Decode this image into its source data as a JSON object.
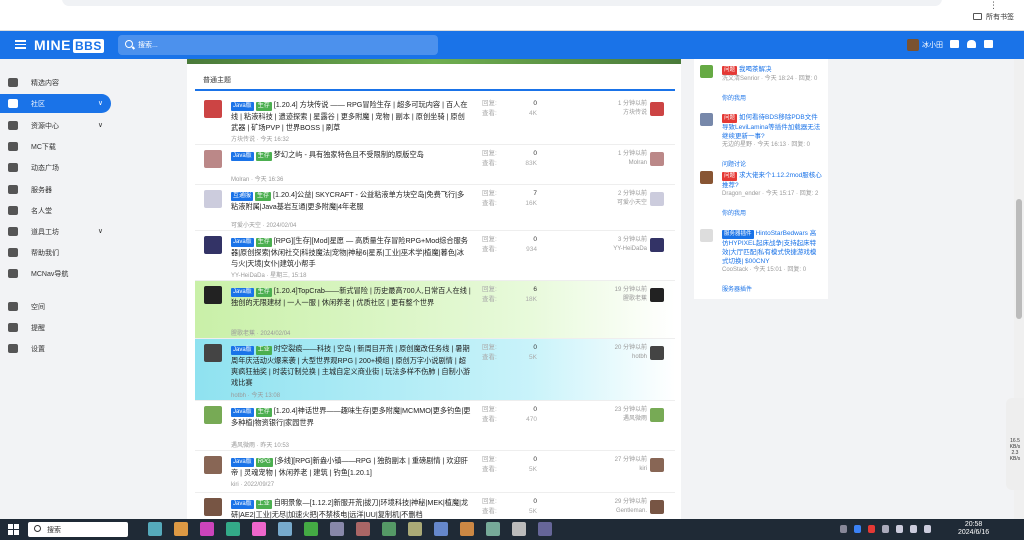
{
  "browser": {
    "bookmarks_label": "所有书签"
  },
  "nav": {
    "logo_a": "MINE",
    "logo_b": "BBS",
    "search_placeholder": "搜索...",
    "username": "冰小田"
  },
  "sidebar": {
    "items": [
      {
        "label": "精选内容",
        "icon": "folder-icon"
      },
      {
        "label": "社区",
        "icon": "chat-icon",
        "chevron": "∨"
      },
      {
        "label": "资源中心",
        "icon": "box-icon",
        "chevron": "∨"
      },
      {
        "label": "MC下载",
        "icon": "download-icon"
      },
      {
        "label": "动态广场",
        "icon": "megaphone-icon"
      },
      {
        "label": "服务器",
        "icon": "server-icon"
      },
      {
        "label": "名人堂",
        "icon": "trophy-icon"
      },
      {
        "label": "道具工坊",
        "icon": "tools-icon",
        "chevron": "∨"
      },
      {
        "label": "帮助我们",
        "icon": "help-icon"
      },
      {
        "label": "MCNav导航",
        "icon": "compass-icon"
      },
      {
        "label": "空间",
        "icon": "user-icon"
      },
      {
        "label": "提醒",
        "icon": "bell-icon"
      },
      {
        "label": "设置",
        "icon": "gear-icon"
      }
    ]
  },
  "main": {
    "section_title": "普通主题",
    "stat_reply": "回复:",
    "stat_view": "查看:",
    "threads": [
      {
        "tags": [
          "Java版",
          "生存"
        ],
        "title": "[1.20.4] 方块传说 —— RPG冒险生存 | 超多可玩内容 | 百人在线 | 粘液科技 | 遗迹探索 | 星露谷 | 更多附魔 | 宠物 | 副本 | 原创坐骑 | 原创武器 | 矿场PVP | 世界BOSS | 刷草",
        "meta": "方块传说 · 今天 16:32",
        "replies": "0",
        "views": "4K",
        "last_time": "1 分钟以前",
        "last_user": "方块传说"
      },
      {
        "tags": [
          "Java版",
          "生存"
        ],
        "title": "梦幻之屿 - 具有独家特色且不受限制的原版空岛",
        "meta": "Molran · 今天 16:36",
        "replies": "0",
        "views": "83K",
        "last_time": "1 分钟以前",
        "last_user": "Molran"
      },
      {
        "tags": [
          "互通服",
          "生存"
        ],
        "title": "[1.20.4]公益| SKYCRAFT - 公益粘液单方块空岛|免费飞行|多粘液附属|Java基岩互通|更多附魔|4年老服",
        "meta": "可爱小天空 · 2024/02/04",
        "replies": "7",
        "views": "16K",
        "last_time": "2 分钟以前",
        "last_user": "可爱小天空"
      },
      {
        "tags": [
          "Java版",
          "生存"
        ],
        "title": "[RPG][生存][Mod]星愿 — 高质量生存冒险RPG+Mod综合服务器|原创探索|休闲社交|科技魔法|宠物|神秘6|星系|工业|巫术学|植魔|暮色|冰与火|天境|女仆|建筑小帮手",
        "meta": "YY-HeiDaDa · 星期三, 15:18",
        "replies": "0",
        "views": "934",
        "last_time": "3 分钟以前",
        "last_user": "YY-HeiDaDa"
      },
      {
        "tags": [
          "Java版",
          "生存"
        ],
        "title": "[1.20.4]TopCrab——新式冒险 | 历史最高700人,日常百人在线 | 独创的无限建材 | 一人一服 | 休闲养老 | 优质社区 | 更有整个世界",
        "meta": "腥歌老蕉 · 2024/02/04",
        "replies": "6",
        "views": "18K",
        "last_time": "19 分钟以前",
        "last_user": "腥歌老蕉"
      },
      {
        "tags": [
          "Java版",
          "工业"
        ],
        "title": "时空裂痕——科技 | 空岛 | 新周目开荒 | 原创魔改任务线 | 暑期周年庆活动火爆来袭 | 大型世界观RPG | 200+模组 | 原创万字小说剧情 | 超爽疯狂抽奖 | 时装订制兑换 | 主城自定义商业街 | 玩法多样不伤肺 | 自制小游戏比赛",
        "meta": "hotbh · 今天 13:08",
        "replies": "0",
        "views": "5K",
        "last_time": "20 分钟以前",
        "last_user": "hotbh"
      },
      {
        "tags": [
          "Java版",
          "生存"
        ],
        "title": "[1.20.4]神话世界——趣味生存|更多附魔|MCMMO|更多钓鱼|更多种植|物资银行|家园世界",
        "meta": "遇风微雨 · 昨天 10:53",
        "replies": "0",
        "views": "470",
        "last_time": "23 分钟以前",
        "last_user": "遇风微雨"
      },
      {
        "tags": [
          "Java版",
          "RPG"
        ],
        "title": "[多线][RPG]新盎小镇——RPG | 独韵副本 | 重磅剧情 | 欢迎肝帝 | 灵魂宠物 | 休闲养老 | 建筑 | 钓鱼[1.20.1]",
        "meta": "kiri · 2022/09/27",
        "replies": "0",
        "views": "5K",
        "last_time": "27 分钟以前",
        "last_user": "kiri"
      },
      {
        "tags": [
          "Java版",
          "工业"
        ],
        "title": "自明景象—[1.12.2]新服开荒|拔刀|环境科技|神秘|MEK|植魔|龙研|AE2|工业|无尽|加速火把|不禁核电|远洋|UU|复制机|不删档",
        "meta": "",
        "replies": "0",
        "views": "5K",
        "last_time": "29 分钟以前",
        "last_user": "Gentleman."
      }
    ]
  },
  "right": {
    "items": [
      {
        "tags": [
          "问题"
        ],
        "title": "我喝茶解决",
        "meta": "洗文清Senrior · 今天 18:24 · 回复: 0",
        "link": "你的我用"
      },
      {
        "tags": [
          "问题"
        ],
        "title": "如何看待BDS移除PDB文件导致LeviLamina等插件加载器无法继续更新一事?",
        "meta": "无边的星野 · 今天 16:13 · 回复: 0",
        "link": "问题讨论"
      },
      {
        "tags": [
          "问题"
        ],
        "title": "求大佬来个1.12.2mod服核心推荐?",
        "meta": "Dragon_ender · 今天 15:17 · 回复: 2",
        "link": "你的我用"
      },
      {
        "tags": [
          "服务器插件"
        ],
        "title": "HintoStarBedwars 高仿HYPIXEL起床战争|支持起床特效|大厅匹配|私有模式快捷游戏模式切换| $00CNY",
        "meta": "CooStack · 今天 15:01 · 回复: 0",
        "link": "服务器插件"
      }
    ]
  },
  "taskbar": {
    "search_label": "搜索",
    "time": "20:58",
    "date": "2024/6/16"
  },
  "widget": {
    "line1": "16.5",
    "line2": "KB/s",
    "line3": "2.3",
    "line4": "KB/s"
  },
  "colors": {
    "accent": "#1a73e8",
    "green_tag": "#4caf50",
    "red_tag": "#e53935"
  }
}
